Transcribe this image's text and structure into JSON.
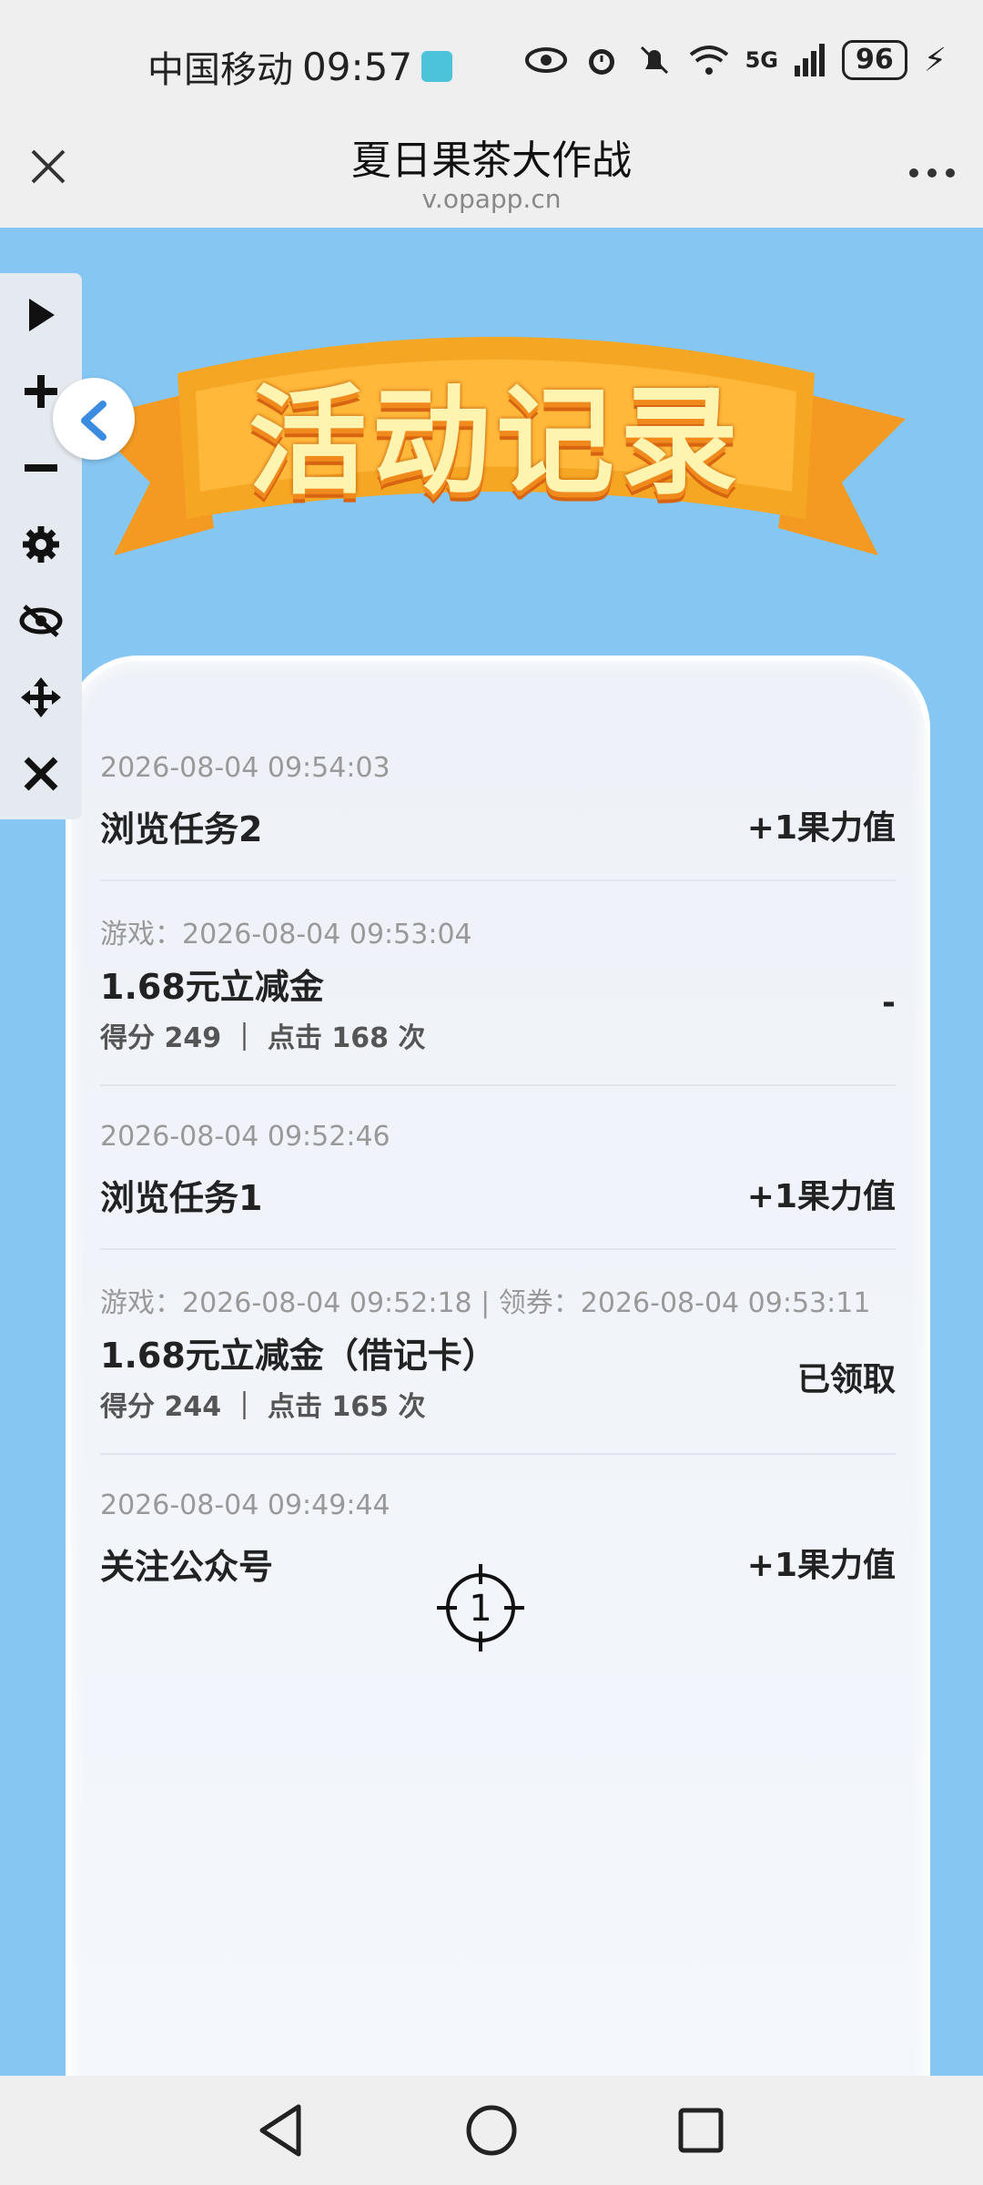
{
  "status": {
    "carrier": "中国移动",
    "time": "09:57",
    "network": "5G",
    "battery": "96"
  },
  "titlebar": {
    "title": "夏日果茶大作战",
    "url": "v.opapp.cn",
    "close_icon": "close-icon",
    "more_icon": "more-icon"
  },
  "banner": {
    "text": "活动记录"
  },
  "records": [
    {
      "meta": "2026-08-04 09:54:03",
      "title": "浏览任务2",
      "right": "+1果力值"
    },
    {
      "meta": "游戏：2026-08-04 09:53:04",
      "title": "1.68元立减金",
      "sub": "得分 249 ｜ 点击 168 次",
      "right": "-"
    },
    {
      "meta": "2026-08-04 09:52:46",
      "title": "浏览任务1",
      "right": "+1果力值"
    },
    {
      "meta": "游戏：2026-08-04 09:52:18 | 领券：2026-08-04 09:53:11",
      "title": "1.68元立减金（借记卡）",
      "sub": "得分 244 ｜ 点击 165 次",
      "right": "已领取"
    },
    {
      "meta": "2026-08-04 09:49:44",
      "title": "关注公众号",
      "right": "+1果力值"
    }
  ],
  "float_toolbar": [
    "play-icon",
    "plus-icon",
    "minus-icon",
    "gear-icon",
    "eye-off-icon",
    "move-icon",
    "close-icon"
  ],
  "crosshair_label": "1",
  "colors": {
    "webview_bg": "#86c6f3",
    "banner_orange": "#f08a1c",
    "accent_blue": "#3b8be0"
  }
}
